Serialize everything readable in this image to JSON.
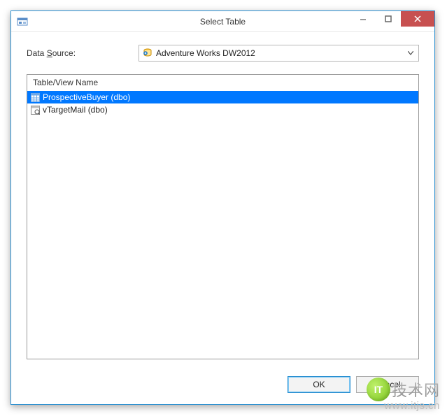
{
  "titlebar": {
    "title": "Select Table"
  },
  "source": {
    "label_prefix": "Data ",
    "label_accel": "S",
    "label_suffix": "ource:",
    "selected": "Adventure Works DW2012"
  },
  "list": {
    "header": "Table/View Name",
    "rows": [
      {
        "label": "ProspectiveBuyer (dbo)",
        "selected": true,
        "icon": "table-icon"
      },
      {
        "label": "vTargetMail (dbo)",
        "selected": false,
        "icon": "view-icon"
      }
    ]
  },
  "buttons": {
    "ok": "OK",
    "cancel": "Cancel"
  },
  "watermark": {
    "badge": "IT",
    "brand": "技术网",
    "url": "www.itjs.cn"
  }
}
